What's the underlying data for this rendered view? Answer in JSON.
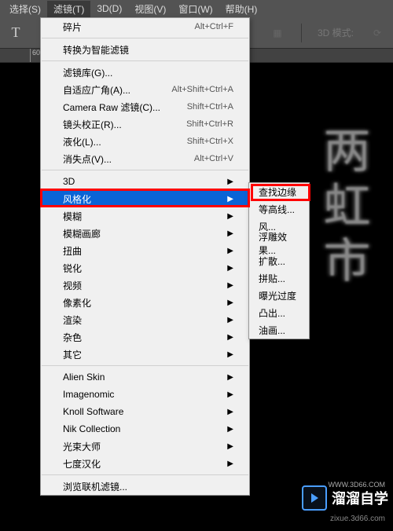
{
  "menubar": {
    "select": "选择(S)",
    "filter": "滤镜(T)",
    "threeD": "3D(D)",
    "view": "视图(V)",
    "window": "窗口(W)",
    "help": "帮助(H)"
  },
  "toolbar": {
    "t_icon": "T",
    "mode_label": "3D 模式:"
  },
  "ruler": {
    "tick0": "60"
  },
  "canvas": {
    "calligraphy": "两虹市"
  },
  "filterMenu": {
    "items": [
      {
        "label": "碎片",
        "shortcut": "Alt+Ctrl+F"
      },
      {
        "sep": true
      },
      {
        "label": "转换为智能滤镜"
      },
      {
        "sep": true
      },
      {
        "label": "滤镜库(G)..."
      },
      {
        "label": "自适应广角(A)...",
        "shortcut": "Alt+Shift+Ctrl+A"
      },
      {
        "label": "Camera Raw 滤镜(C)...",
        "shortcut": "Shift+Ctrl+A"
      },
      {
        "label": "镜头校正(R)...",
        "shortcut": "Shift+Ctrl+R"
      },
      {
        "label": "液化(L)...",
        "shortcut": "Shift+Ctrl+X"
      },
      {
        "label": "消失点(V)...",
        "shortcut": "Alt+Ctrl+V"
      },
      {
        "sep": true
      },
      {
        "label": "3D",
        "arrow": true
      },
      {
        "label": "风格化",
        "arrow": true,
        "hl": true
      },
      {
        "label": "模糊",
        "arrow": true
      },
      {
        "label": "模糊画廊",
        "arrow": true
      },
      {
        "label": "扭曲",
        "arrow": true
      },
      {
        "label": "锐化",
        "arrow": true
      },
      {
        "label": "视频",
        "arrow": true
      },
      {
        "label": "像素化",
        "arrow": true
      },
      {
        "label": "渲染",
        "arrow": true
      },
      {
        "label": "杂色",
        "arrow": true
      },
      {
        "label": "其它",
        "arrow": true
      },
      {
        "sep": true
      },
      {
        "label": "Alien Skin",
        "arrow": true
      },
      {
        "label": "Imagenomic",
        "arrow": true
      },
      {
        "label": "Knoll Software",
        "arrow": true
      },
      {
        "label": "Nik Collection",
        "arrow": true
      },
      {
        "label": "光束大师",
        "arrow": true
      },
      {
        "label": "七度汉化",
        "arrow": true
      },
      {
        "sep": true
      },
      {
        "label": "浏览联机滤镜..."
      }
    ]
  },
  "stylizeSubmenu": {
    "items": [
      {
        "label": "查找边缘"
      },
      {
        "label": "等高线..."
      },
      {
        "label": "风..."
      },
      {
        "label": "浮雕效果..."
      },
      {
        "label": "扩散..."
      },
      {
        "label": "拼贴..."
      },
      {
        "label": "曝光过度"
      },
      {
        "label": "凸出..."
      },
      {
        "label": "油画..."
      }
    ]
  },
  "watermark": {
    "brand": "溜溜自学",
    "sub": "zixue.3d66.com",
    "url": "WWW.3D66.COM"
  }
}
